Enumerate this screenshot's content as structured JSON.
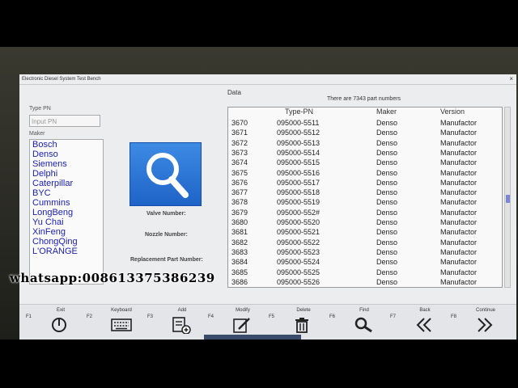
{
  "window": {
    "title": "Electronic Diesel System Test Bench",
    "close": "×"
  },
  "left": {
    "type_pn_label": "Type PN",
    "type_pn_placeholder": "Input PN",
    "maker_label": "Maker",
    "makers": [
      "Bosch",
      "Denso",
      "Siemens",
      "Delphi",
      "Caterpillar",
      "BYC",
      "Cummins",
      "LongBeng",
      "Yu Chai",
      "XinFeng",
      "ChongQing",
      "L'ORANGE"
    ]
  },
  "fields": {
    "valve": "Valve Number:",
    "nozzle": "Nozzle Number:",
    "replacement": "Replacement Part Number:"
  },
  "data": {
    "title": "Data",
    "count_text": "There are 7343 part numbers",
    "columns": [
      "",
      "Type-PN",
      "Maker",
      "Version"
    ],
    "rows": [
      [
        "3670",
        "095000-5511",
        "Denso",
        "Manufactor"
      ],
      [
        "3671",
        "095000-5512",
        "Denso",
        "Manufactor"
      ],
      [
        "3672",
        "095000-5513",
        "Denso",
        "Manufactor"
      ],
      [
        "3673",
        "095000-5514",
        "Denso",
        "Manufactor"
      ],
      [
        "3674",
        "095000-5515",
        "Denso",
        "Manufactor"
      ],
      [
        "3675",
        "095000-5516",
        "Denso",
        "Manufactor"
      ],
      [
        "3676",
        "095000-5517",
        "Denso",
        "Manufactor"
      ],
      [
        "3677",
        "095000-5518",
        "Denso",
        "Manufactor"
      ],
      [
        "3678",
        "095000-5519",
        "Denso",
        "Manufactor"
      ],
      [
        "3679",
        "095000-552#",
        "Denso",
        "Manufactor"
      ],
      [
        "3680",
        "095000-5520",
        "Denso",
        "Manufactor"
      ],
      [
        "3681",
        "095000-5521",
        "Denso",
        "Manufactor"
      ],
      [
        "3682",
        "095000-5522",
        "Denso",
        "Manufactor"
      ],
      [
        "3683",
        "095000-5523",
        "Denso",
        "Manufactor"
      ],
      [
        "3684",
        "095000-5524",
        "Denso",
        "Manufactor"
      ],
      [
        "3685",
        "095000-5525",
        "Denso",
        "Manufactor"
      ],
      [
        "3686",
        "095000-5526",
        "Denso",
        "Manufactor"
      ]
    ]
  },
  "function_keys": [
    {
      "key": "F1",
      "label": "Exit",
      "icon": "power-icon"
    },
    {
      "key": "F2",
      "label": "Keyboard",
      "icon": "keyboard-icon"
    },
    {
      "key": "F3",
      "label": "Add",
      "icon": "add-list-icon"
    },
    {
      "key": "F4",
      "label": "Modify",
      "icon": "edit-icon"
    },
    {
      "key": "F5",
      "label": "Delete",
      "icon": "trash-icon"
    },
    {
      "key": "F6",
      "label": "Find",
      "icon": "find-icon"
    },
    {
      "key": "F7",
      "label": "Back",
      "icon": "back-icon"
    },
    {
      "key": "F8",
      "label": "Continue",
      "icon": "continue-icon"
    }
  ],
  "watermark": "whatsapp:008613375386239",
  "colors": {
    "accent": "#1f63c8",
    "maker_text": "#1a1fb0",
    "screen_bg": "#ecedef"
  }
}
